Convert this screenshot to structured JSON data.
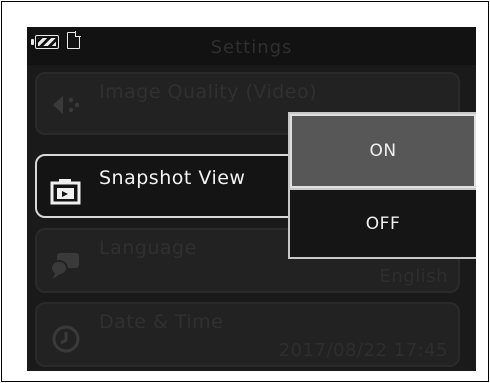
{
  "header": {
    "title": "Settings"
  },
  "status": {
    "battery_icon": "battery-icon",
    "card_icon": "memory-card-icon"
  },
  "menu": {
    "items": [
      {
        "label": "Image Quality (Video)",
        "value": "",
        "icon": "video-quality-icon"
      },
      {
        "label": "Snapshot View",
        "value": "",
        "icon": "snapshot-camera-icon"
      },
      {
        "label": "Language",
        "value": "English",
        "icon": "language-icon"
      },
      {
        "label": "Date & Time",
        "value": "2017/08/22 17:45",
        "icon": "clock-icon"
      }
    ]
  },
  "popup": {
    "options": [
      "ON",
      "OFF"
    ],
    "selected": "ON"
  },
  "colors": {
    "screen_bg": "#1a1a1a",
    "selected_option": "#575757",
    "border_highlight": "#e0e0e0"
  }
}
